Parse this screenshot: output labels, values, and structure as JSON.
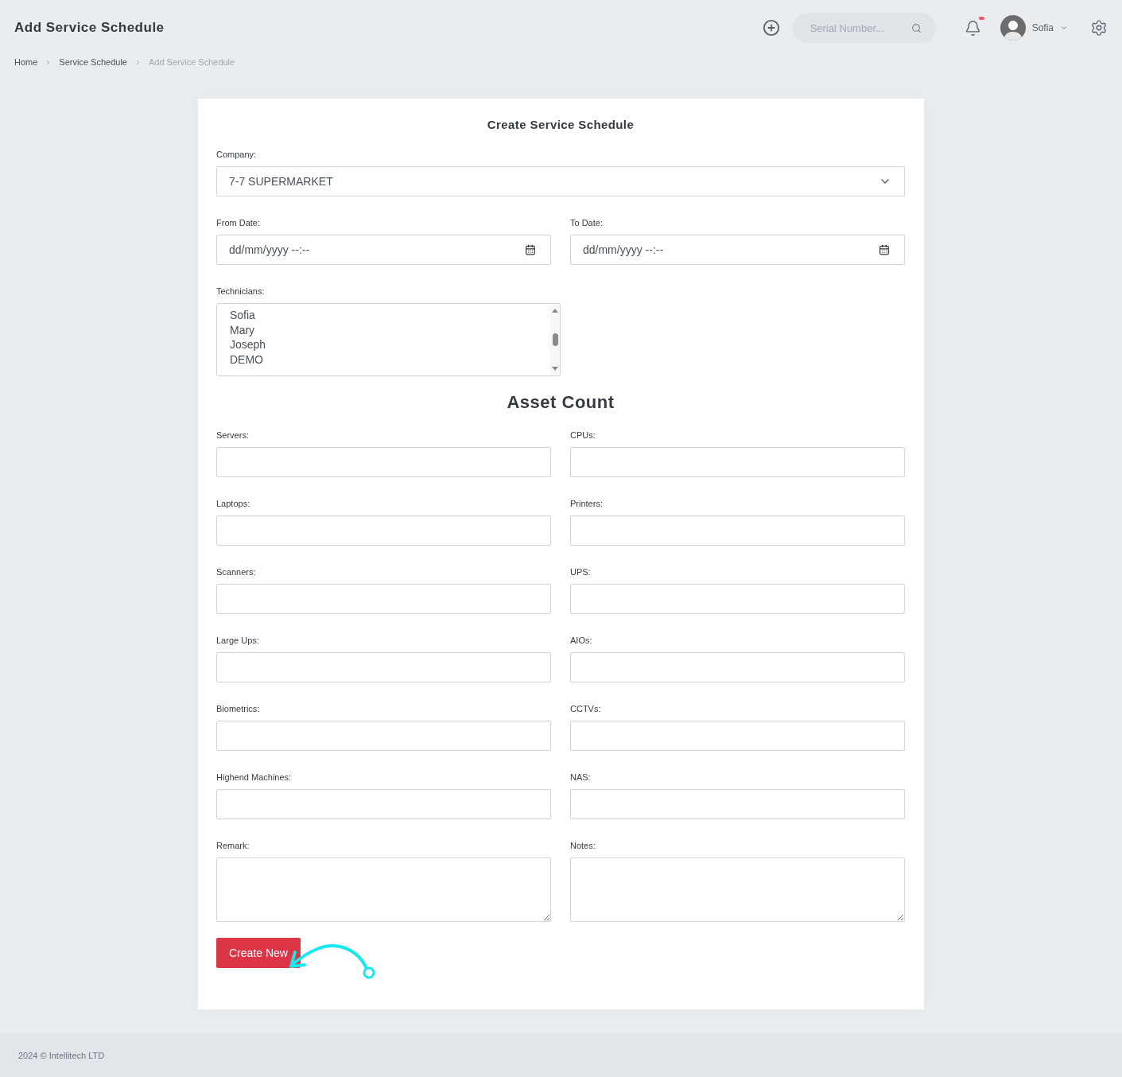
{
  "header": {
    "title": "Add Service Schedule",
    "search": {
      "placeholder": "Serial Number..."
    },
    "notification_dot": true,
    "user": "Sofia"
  },
  "breadcrumb": [
    {
      "label": "Home",
      "current": false
    },
    {
      "label": "Service Schedule",
      "current": false
    },
    {
      "label": "Add Service Schedule",
      "current": true
    }
  ],
  "form": {
    "title": "Create Service Schedule",
    "company": {
      "label": "Company:",
      "value": "7-7 SUPERMARKET"
    },
    "dates": [
      {
        "label": "From Date:",
        "value": "dd/mm/yyyy --:--"
      },
      {
        "label": "To Date:",
        "value": "dd/mm/yyyy --:--"
      }
    ],
    "technicians": {
      "label": "Technicians:",
      "options": [
        "Sofia",
        "Mary",
        "Joseph",
        "DEMO"
      ]
    },
    "section_title": "Asset Count",
    "fields": [
      {
        "label": "Servers:",
        "kind": "input"
      },
      {
        "label": "CPUs:",
        "kind": "input"
      },
      {
        "label": "Laptops:",
        "kind": "input"
      },
      {
        "label": "Printers:",
        "kind": "input"
      },
      {
        "label": "Scanners:",
        "kind": "input"
      },
      {
        "label": "UPS:",
        "kind": "input"
      },
      {
        "label": "Large Ups:",
        "kind": "input"
      },
      {
        "label": "AIOs:",
        "kind": "input"
      },
      {
        "label": "Biometrics:",
        "kind": "input"
      },
      {
        "label": "CCTVs:",
        "kind": "input"
      },
      {
        "label": "Highend Machines:",
        "kind": "input"
      },
      {
        "label": "NAS:",
        "kind": "input"
      },
      {
        "label": "Remark:",
        "kind": "textarea"
      },
      {
        "label": "Notes:",
        "kind": "textarea"
      }
    ],
    "submit": "Create New"
  },
  "footer": "2024 © Intellitech LTD"
}
